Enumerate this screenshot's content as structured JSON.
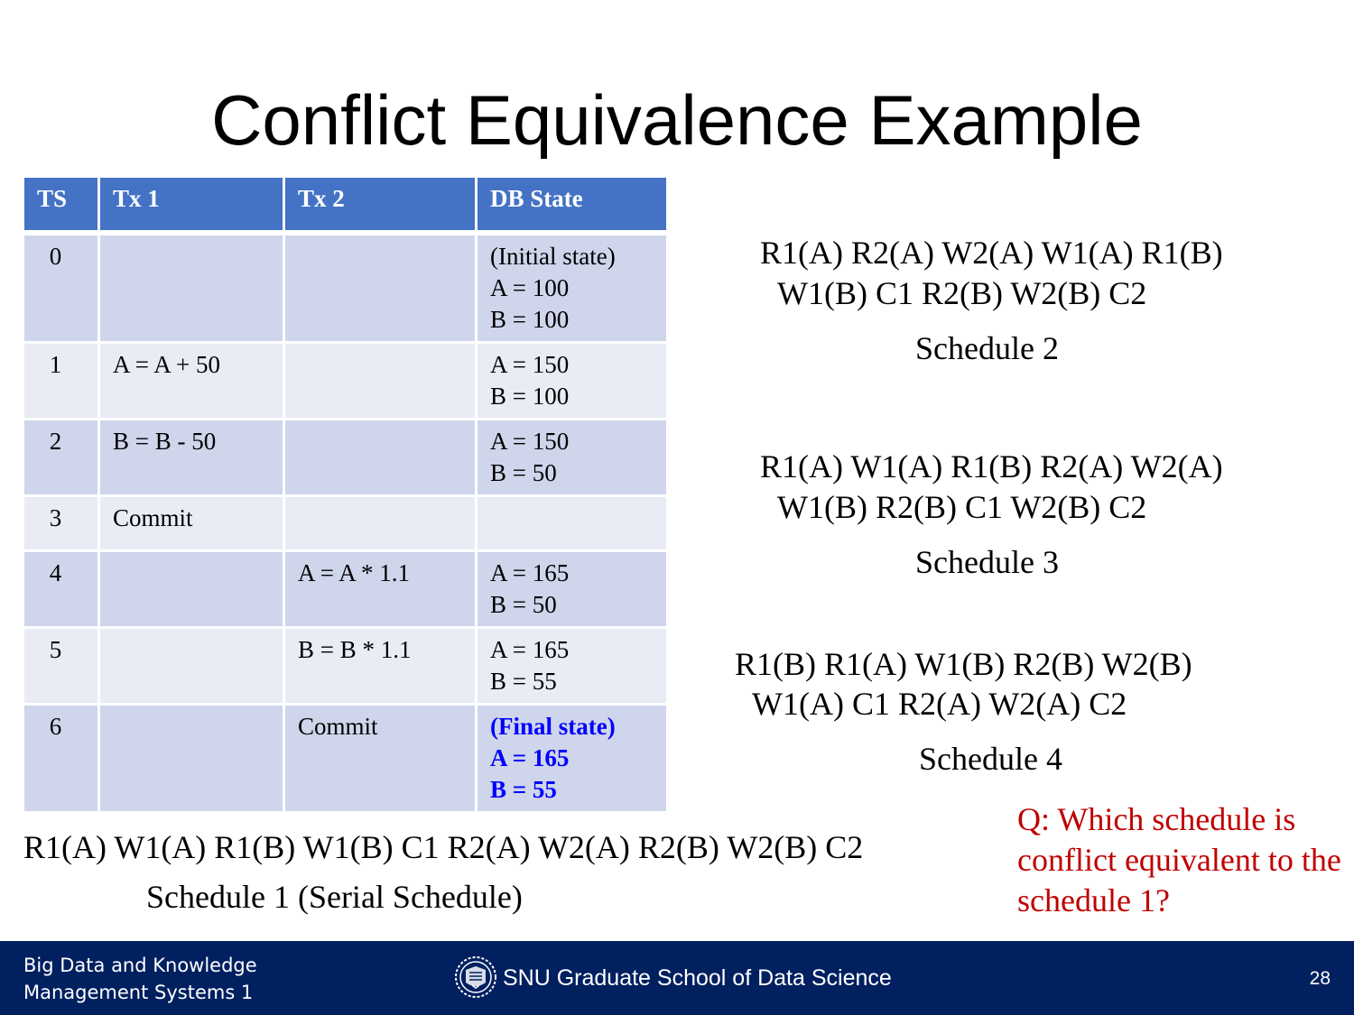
{
  "slide": {
    "title": "Conflict Equivalence Example",
    "question": "Q: Which schedule is conflict equivalent to the schedule 1?",
    "page_number": "28"
  },
  "table": {
    "headers": [
      "TS",
      "Tx 1",
      "Tx 2",
      "DB State"
    ],
    "rows": [
      {
        "ts": "0",
        "tx1": "",
        "tx2": "",
        "db": [
          "(Initial state)",
          "A = 100",
          "B = 100"
        ],
        "final": false
      },
      {
        "ts": "1",
        "tx1": "A = A + 50",
        "tx2": "",
        "db": [
          "A = 150",
          "B = 100"
        ],
        "final": false
      },
      {
        "ts": "2",
        "tx1": "B = B - 50",
        "tx2": "",
        "db": [
          "A = 150",
          "B = 50"
        ],
        "final": false
      },
      {
        "ts": "3",
        "tx1": "Commit",
        "tx2": "",
        "db": [],
        "final": false
      },
      {
        "ts": "4",
        "tx1": "",
        "tx2": "A = A * 1.1",
        "db": [
          "A = 165",
          "B = 50"
        ],
        "final": false
      },
      {
        "ts": "5",
        "tx1": "",
        "tx2": "B = B * 1.1",
        "db": [
          "A = 165",
          "B = 55"
        ],
        "final": false
      },
      {
        "ts": "6",
        "tx1": "",
        "tx2": "Commit",
        "db": [
          "(Final state)",
          "A = 165",
          "B = 55"
        ],
        "final": true
      }
    ]
  },
  "schedules": {
    "s1": {
      "ops": [
        "R1(A) W1(A) R1(B) W1(B) C1 R2(A) W2(A) R2(B) W2(B) C2"
      ],
      "label": "Schedule 1 (Serial Schedule)"
    },
    "s2": {
      "ops": [
        "R1(A) R2(A) W2(A) W1(A) R1(B)",
        "W1(B) C1 R2(B) W2(B) C2"
      ],
      "label": "Schedule 2"
    },
    "s3": {
      "ops": [
        "R1(A) W1(A) R1(B) R2(A) W2(A)",
        "W1(B) R2(B) C1 W2(B) C2"
      ],
      "label": "Schedule 3"
    },
    "s4": {
      "ops": [
        "R1(B) R1(A) W1(B) R2(B) W2(B)",
        "W1(A) C1 R2(A) W2(A) C2"
      ],
      "label": "Schedule 4"
    }
  },
  "footer": {
    "course_line1": "Big Data and Knowledge",
    "course_line2": "Management Systems 1",
    "school": "SNU Graduate School of Data Science",
    "logo_icon": "snu-emblem-icon"
  },
  "colors": {
    "header_bg": "#4472c4",
    "row_odd": "#cfd5ea",
    "row_even": "#e9ebf5",
    "final_state": "#0000ff",
    "question": "#c00000",
    "footer_bg": "#002060"
  }
}
